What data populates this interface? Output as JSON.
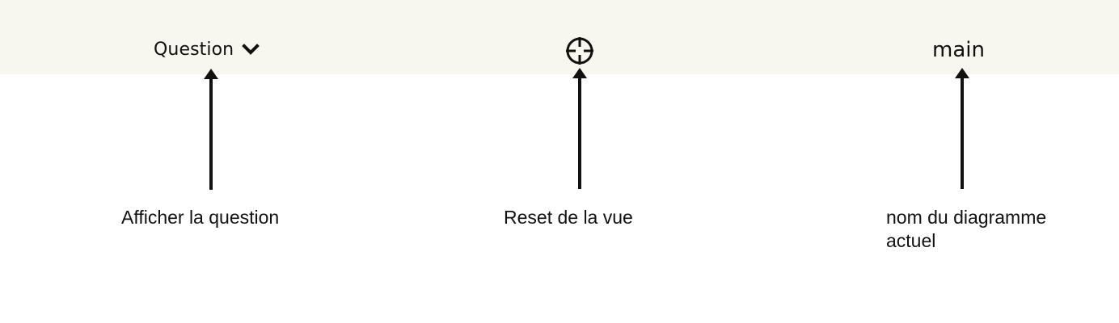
{
  "toolbar": {
    "question_label": "Question",
    "question_icon": "chevron-down-icon",
    "reset_icon": "crosshair-icon",
    "diagram_name": "main",
    "background_color": "#f7f7f0"
  },
  "annotations": {
    "question": "Afficher la question",
    "reset": "Reset de la vue",
    "diagram_line1": "nom du diagramme",
    "diagram_line2": "actuel"
  }
}
